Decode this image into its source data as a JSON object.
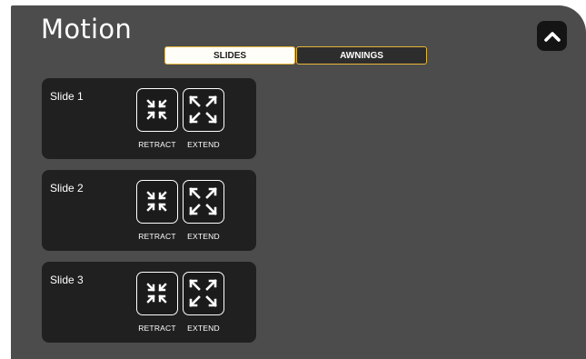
{
  "page": {
    "title": "Motion"
  },
  "tabs": [
    {
      "label": "SLIDES",
      "active": true
    },
    {
      "label": "AWNINGS",
      "active": false
    }
  ],
  "collapse_button": {
    "icon": "chevron-up-icon"
  },
  "slides": [
    {
      "name": "Slide 1",
      "retract_label": "RETRACT",
      "extend_label": "EXTEND"
    },
    {
      "name": "Slide 2",
      "retract_label": "RETRACT",
      "extend_label": "EXTEND"
    },
    {
      "name": "Slide 3",
      "retract_label": "RETRACT",
      "extend_label": "EXTEND"
    }
  ],
  "icons": {
    "retract": "retract-arrows-icon",
    "extend": "extend-arrows-icon"
  },
  "colors": {
    "panel_bg": "#4b4c4b",
    "card_bg": "#202020",
    "tab_border": "#e7b53a",
    "active_tab_bg": "#fffdf7",
    "inactive_tab_bg": "#2d2d2d"
  }
}
